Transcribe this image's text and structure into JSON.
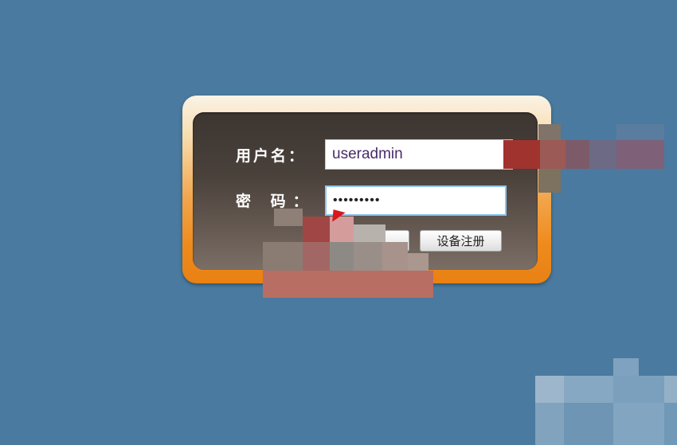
{
  "login": {
    "username_label": "用户名：",
    "password_label": "密  码：",
    "username_value": "useradmin",
    "password_value": "•••••••••",
    "register_button": "设备注册",
    "login_button": ""
  },
  "colors": {
    "background": "#4a7a9f",
    "frame_orange": "#ee8a1c",
    "panel_dark": "#3c3531"
  }
}
